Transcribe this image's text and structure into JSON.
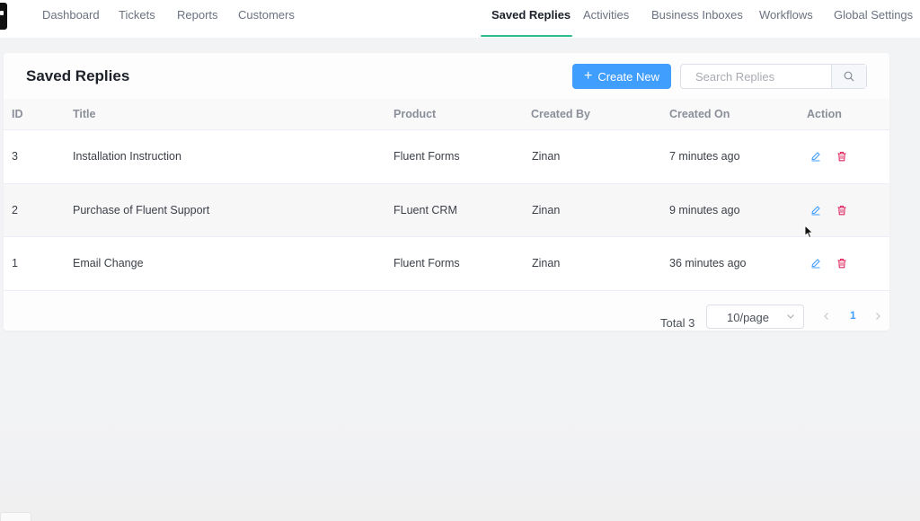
{
  "nav": {
    "left": [
      "Dashboard",
      "Tickets",
      "Reports",
      "Customers"
    ],
    "right": [
      "Saved Replies",
      "Activities",
      "Business Inboxes",
      "Workflows",
      "Global Settings"
    ],
    "active": "Saved Replies"
  },
  "page": {
    "title": "Saved Replies",
    "create_label": "Create New",
    "search_placeholder": "Search Replies"
  },
  "table": {
    "headers": {
      "id": "ID",
      "title": "Title",
      "product": "Product",
      "created_by": "Created By",
      "created_on": "Created On",
      "action": "Action"
    },
    "rows": [
      {
        "id": "3",
        "title": "Installation Instruction",
        "product": "Fluent Forms",
        "created_by": "Zinan",
        "created_on": "7 minutes ago"
      },
      {
        "id": "2",
        "title": "Purchase of Fluent Support",
        "product": "FLuent CRM",
        "created_by": "Zinan",
        "created_on": "9 minutes ago"
      },
      {
        "id": "1",
        "title": "Email Change",
        "product": "Fluent Forms",
        "created_by": "Zinan",
        "created_on": "36 minutes ago"
      }
    ]
  },
  "pagination": {
    "total_label": "Total 3",
    "page_size": "10/page",
    "current_page": "1"
  },
  "colors": {
    "primary": "#409eff",
    "nav_active_underline": "#2dbd8a",
    "edit_icon": "#409eff",
    "delete_icon": "#e0245e"
  },
  "icons": {
    "create": "plus-icon",
    "search": "search-icon",
    "edit": "edit-icon",
    "delete": "trash-icon",
    "dropdown": "chevron-down-icon",
    "prev": "chevron-left-icon",
    "next": "chevron-right-icon"
  }
}
